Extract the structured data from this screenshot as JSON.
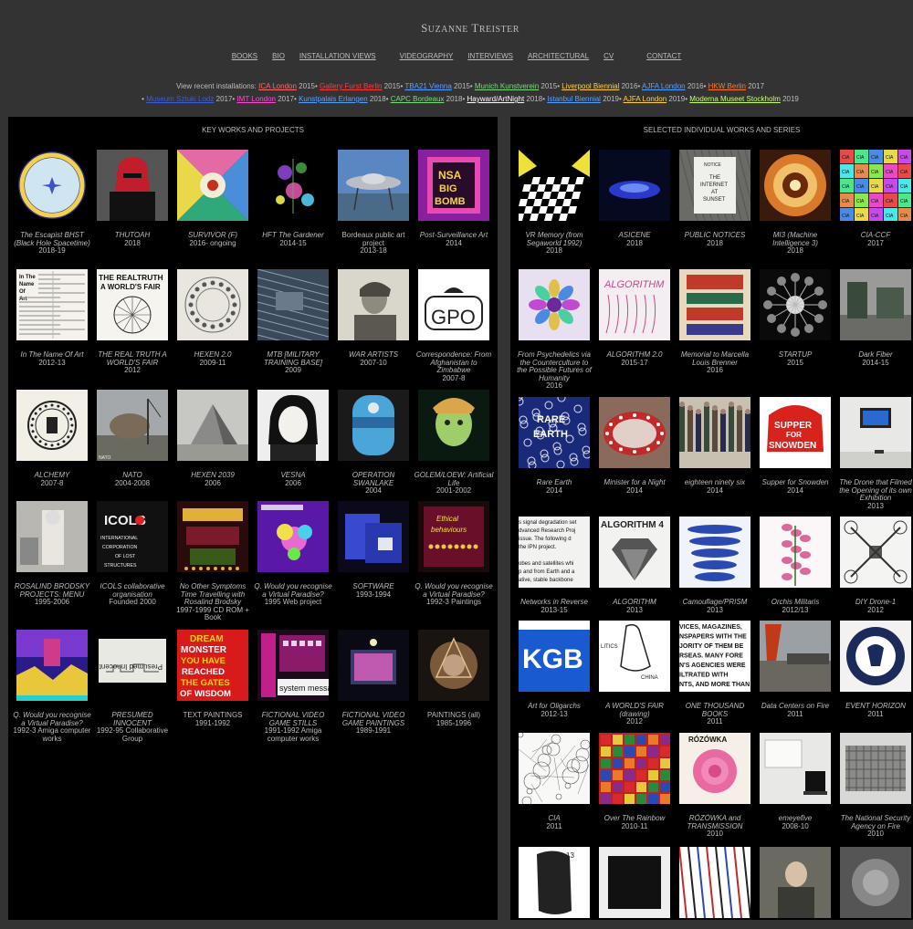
{
  "header": {
    "title_first_initial": "S",
    "title_first_rest": "uzanne",
    "title_last_initial": "T",
    "title_last_rest": "reister"
  },
  "nav": [
    "BOOKS",
    "BIO",
    "INSTALLATION VIEWS",
    "VIDEOGRAPHY",
    "INTERVIEWS",
    "ARCHITECTURAL",
    "CV",
    "CONTACT"
  ],
  "recent": {
    "label": "View recent installations:",
    "line1": [
      {
        "link": "ICA London",
        "year": "2015",
        "color": "#ff6b6b"
      },
      {
        "link": "Gallery Furst Berlin",
        "year": "2015",
        "color": "#ff3b3b"
      },
      {
        "link": "TBA21 Vienna",
        "year": "2015",
        "color": "#5aa0ff"
      },
      {
        "link": "Munich Kunstverein",
        "year": "2015",
        "color": "#7fd97f"
      },
      {
        "link": "Liverpool Biennial",
        "year": "2016",
        "color": "#ffd24a"
      },
      {
        "link": "AJFA London",
        "year": "2016",
        "color": "#5aa0ff"
      },
      {
        "link": "HKW Berlin",
        "year": "2017",
        "color": "#ff7a2e"
      }
    ],
    "line2": [
      {
        "link": "Museum Sztuki Lodz",
        "year": "2017",
        "color": "#3b5dd9"
      },
      {
        "link": "IMT London",
        "year": "2017",
        "color": "#ff4ad8"
      },
      {
        "link": "Kunstpalais Erlangen",
        "year": "2018",
        "color": "#5aa0ff"
      },
      {
        "link": "CAPC Bordeaux",
        "year": "2018",
        "color": "#7fd97f"
      },
      {
        "link": "Hayward/ArtNight",
        "year": "2018",
        "color": "#ffffff"
      },
      {
        "link": "Istanbul Biennial",
        "year": "2019",
        "color": "#5aa0ff"
      },
      {
        "link": "AJFA London",
        "year": "2019",
        "color": "#ffd24a"
      },
      {
        "link": "Moderna Museet Stockholm",
        "year": "2019",
        "color": "#c8ff6a"
      }
    ]
  },
  "left_panel": {
    "title": "KEY WORKS AND PROJECTS",
    "works": [
      {
        "title": "The Escapist BHST (Black Hole Spacetime)",
        "date": "2018-19",
        "italic": true,
        "thumb": "escapist"
      },
      {
        "title": "THUTOAH",
        "date": "2018",
        "italic": true,
        "thumb": "thutoah"
      },
      {
        "title": "SURVIVOR (F)",
        "date": "2016- ongoing",
        "italic": true,
        "thumb": "survivor"
      },
      {
        "title": "HFT The Gardener",
        "date": "2014-15",
        "italic": true,
        "thumb": "hft"
      },
      {
        "title": "Bordeaux public art project",
        "date": "2013-18",
        "italic": false,
        "thumb": "bordeaux"
      },
      {
        "title": "Post-Surveillance Art",
        "date": "2014",
        "italic": true,
        "thumb": "postsurv"
      },
      {
        "title": "In The Name Of Art",
        "date": "2012-13",
        "italic": true,
        "thumb": "nameofart"
      },
      {
        "title": "THE REAL TRUTH A WORLD'S FAIR",
        "date": "2012",
        "italic": true,
        "thumb": "realtruth"
      },
      {
        "title": "HEXEN 2.0",
        "date": "2009-11",
        "italic": true,
        "thumb": "hexen2"
      },
      {
        "title": "MTB [MILITARY TRAINING BASE]",
        "date": "2009",
        "italic": true,
        "thumb": "mtb"
      },
      {
        "title": "WAR ARTISTS",
        "date": "2007-10",
        "italic": true,
        "thumb": "warartists"
      },
      {
        "title": "Correspondence: From Afghanistan to Zimbabwe",
        "date": "2007-8",
        "italic": true,
        "thumb": "gpo"
      },
      {
        "title": "ALCHEMY",
        "date": "2007-8",
        "italic": true,
        "thumb": "alchemy"
      },
      {
        "title": "NATO",
        "date": "2004-2008",
        "italic": true,
        "thumb": "nato"
      },
      {
        "title": "HEXEN 2039",
        "date": "2006",
        "italic": true,
        "thumb": "hexen2039"
      },
      {
        "title": "VESNA",
        "date": "2006",
        "italic": true,
        "thumb": "vesna"
      },
      {
        "title": "OPERATION SWANLAKE",
        "date": "2004",
        "italic": true,
        "thumb": "swanlake"
      },
      {
        "title": "GOLEM/LOEW: Artificial Life",
        "date": "2001-2002",
        "italic": true,
        "thumb": "golem"
      },
      {
        "title": "ROSALIND BRODSKY PROJECTS: MENU",
        "date": "1995-2006",
        "italic": true,
        "thumb": "rosalind"
      },
      {
        "title": "ICOLS collaborative organisation",
        "date": "Founded 2000",
        "italic": true,
        "thumb": "icols"
      },
      {
        "title": "No Other Symptoms Time Travelling with Rosalind Brodsky",
        "date": "1997-1999 CD ROM + Book",
        "italic": true,
        "thumb": "noother"
      },
      {
        "title": "Q. Would you recognise a Virtual Paradise?",
        "date": "1995 Web project",
        "italic": true,
        "thumb": "qweb"
      },
      {
        "title": "SOFTWARE",
        "date": "1993-1994",
        "italic": true,
        "thumb": "software"
      },
      {
        "title": "Q. Would you recognise a Virtual Paradise?",
        "date": "1992-3 Paintings",
        "italic": true,
        "thumb": "qpaint"
      },
      {
        "title": "Q. Would you recognise a Virtual Paradise?",
        "date": "1992-3 Amiga computer works",
        "italic": true,
        "thumb": "qamiga"
      },
      {
        "title": "PRESUMED INNOCENT",
        "date": "1992-95 Collaborative Group",
        "italic": true,
        "thumb": "presumed"
      },
      {
        "title": "TEXT PAINTINGS",
        "date": "1991-1992",
        "italic": false,
        "thumb": "textpaint"
      },
      {
        "title": "FICTIONAL VIDEO GAME STILLS",
        "date": "1991-1992 Amiga computer works",
        "italic": true,
        "thumb": "fvgstills"
      },
      {
        "title": "FICTIONAL VIDEO GAME PAINTINGS",
        "date": "1989-1991",
        "italic": true,
        "thumb": "fvgpaint"
      },
      {
        "title": "PAINTINGS (all)",
        "date": "1985-1996",
        "italic": false,
        "thumb": "paintings"
      }
    ]
  },
  "right_panel": {
    "title": "SELECTED INDIVIDUAL WORKS AND SERIES",
    "works": [
      {
        "title": "VR Memory (from Segaworld 1992)",
        "date": "2018",
        "italic": true,
        "thumb": "vrmemory"
      },
      {
        "title": "ASICENE",
        "date": "2018",
        "italic": true,
        "thumb": "asicene"
      },
      {
        "title": "PUBLIC NOTICES",
        "date": "2018",
        "italic": true,
        "thumb": "notices"
      },
      {
        "title": "MI3 (Machine Intelligence 3)",
        "date": "2018",
        "italic": true,
        "thumb": "mi3"
      },
      {
        "title": "CIA-CCF",
        "date": "2017",
        "italic": true,
        "thumb": "ciaccf"
      },
      {
        "title": "From Psychedelics via the Counterculture to the Possible Futures of Humanity",
        "date": "2016",
        "italic": true,
        "thumb": "psychedelics"
      },
      {
        "title": "ALGORITHM 2.0",
        "date": "2015-17",
        "italic": true,
        "thumb": "algorithm2"
      },
      {
        "title": "Memorial to Marcella Louis Brenner",
        "date": "2016",
        "italic": true,
        "thumb": "memorial"
      },
      {
        "title": "STARTUP",
        "date": "2015",
        "italic": true,
        "thumb": "startup"
      },
      {
        "title": "Dark Fiber",
        "date": "2014-15",
        "italic": true,
        "thumb": "darkfiber"
      },
      {
        "title": "Rare Earth",
        "date": "2014",
        "italic": true,
        "thumb": "rareearth"
      },
      {
        "title": "Minister for a Night",
        "date": "2014",
        "italic": true,
        "thumb": "minister"
      },
      {
        "title": "eighteen ninety six",
        "date": "2014",
        "italic": true,
        "thumb": "eighteen"
      },
      {
        "title": "Supper for Snowden",
        "date": "2014",
        "italic": true,
        "thumb": "snowden"
      },
      {
        "title": "The Drone that Filmed the Opening of its own Exhibition",
        "date": "2013",
        "italic": true,
        "thumb": "drone"
      },
      {
        "title": "Networks in Reverse",
        "date": "2013-15",
        "italic": true,
        "thumb": "networks"
      },
      {
        "title": "ALGORITHM",
        "date": "2013",
        "italic": true,
        "thumb": "algorithm"
      },
      {
        "title": "Camouflage/PRISM",
        "date": "2013",
        "italic": true,
        "thumb": "camouflage"
      },
      {
        "title": "Orchis Militaris",
        "date": "2012/13",
        "italic": true,
        "thumb": "orchis"
      },
      {
        "title": "DIY Drone-1",
        "date": "2012",
        "italic": true,
        "thumb": "diydrone"
      },
      {
        "title": "Art for Oligarchs",
        "date": "2012-13",
        "italic": true,
        "thumb": "oligarchs"
      },
      {
        "title": "A WORLD'S FAIR (drawing)",
        "date": "2012",
        "italic": true,
        "thumb": "worldsfair"
      },
      {
        "title": "ONE THOUSAND BOOKS",
        "date": "2011",
        "italic": true,
        "thumb": "thousand"
      },
      {
        "title": "Data Centers on Fire",
        "date": "2011",
        "italic": true,
        "thumb": "datacenters"
      },
      {
        "title": "EVENT HORIZON",
        "date": "2011",
        "italic": true,
        "thumb": "cia"
      },
      {
        "title": "CIA",
        "date": "2011",
        "italic": true,
        "thumb": "ciadraw"
      },
      {
        "title": "Over The Rainbow",
        "date": "2010-11",
        "italic": true,
        "thumb": "rainbow"
      },
      {
        "title": "RÓZÓWKA and TRANSMISSION",
        "date": "2010",
        "italic": true,
        "thumb": "rozowka"
      },
      {
        "title": "emeyefive",
        "date": "2008-10",
        "italic": true,
        "thumb": "emeyefive"
      },
      {
        "title": "The National Security Agency on Fire",
        "date": "2010",
        "italic": true,
        "thumb": "nsa"
      },
      {
        "title": "",
        "date": "",
        "italic": true,
        "thumb": "r7a"
      },
      {
        "title": "",
        "date": "",
        "italic": true,
        "thumb": "r7b"
      },
      {
        "title": "",
        "date": "",
        "italic": true,
        "thumb": "r7c"
      },
      {
        "title": "",
        "date": "",
        "italic": true,
        "thumb": "r7d"
      },
      {
        "title": "",
        "date": "",
        "italic": true,
        "thumb": "r7e"
      }
    ]
  },
  "thumb_text": {
    "escapist": "THE ESCAPIST",
    "postsurv": "NSA BIG BOMB",
    "realtruth": "THE REALTRUTH A WORLD'S FAIR",
    "gpo": "GPO",
    "nameofart": "In The Name Of Art",
    "icols": "ICOLS INTERNATIONAL CORPORATION OF LOST STRUCTURES",
    "presumed": "Presumed Innocent",
    "textpaint": "DREAM MONSTER YOU HAVE REACHED THE GATES OF WISDOM",
    "fvgstills": "system messa",
    "notices": "NOTICE THE INTERNET AT SUNSET",
    "algorithm2": "ALGORITHM",
    "algorithm": "ALGORITHM 4",
    "snowden": "SUPPER FOR SNOWDEN",
    "oligarchs": "KGB",
    "thousand": "VICES, MAGAZINES, NSPAPERS WITH THE JORITY OF THEM BE RSEAS. MANY FORE N'S AGENCIES WERE ILTRATED WITH NTS, AND MORE THAN",
    "rozowka": "RÓZÓWKA",
    "networks": "s signal degradation set dvanced Research Proj issue. The following d the IPN project. obes and satellites whi p and from Earth and a ative, stable backbone",
    "rareearth": "RARE EARTH",
    "ciaccf": "CIA CIA CIA"
  },
  "colors": {
    "page_bg": "#333333",
    "panel_bg": "#000000",
    "text": "#bdbdbd"
  }
}
